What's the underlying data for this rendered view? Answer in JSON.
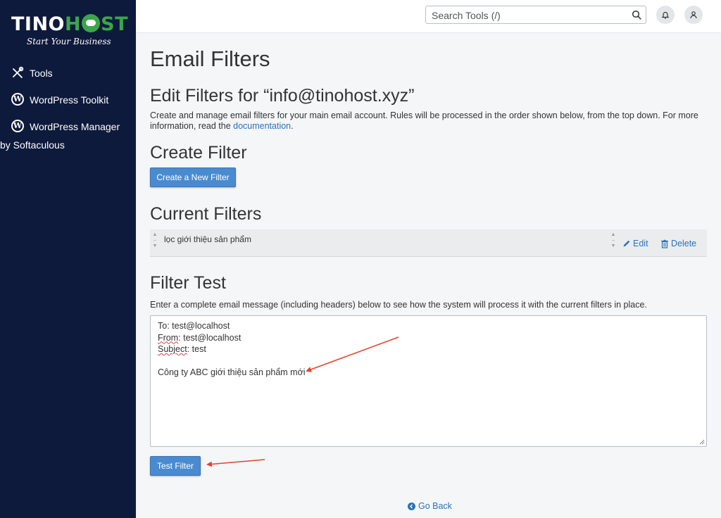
{
  "brand": {
    "part1": "TINO",
    "part2": "HOST",
    "tagline": "Start Your Business",
    "accent": "#3aa64a"
  },
  "sidebar": {
    "items": [
      {
        "label": "Tools",
        "icon": "tools-icon"
      },
      {
        "label": "WordPress Toolkit",
        "icon": "wordpress-icon"
      },
      {
        "label": "WordPress Manager",
        "label2": "by Softaculous",
        "icon": "wordpress-icon"
      }
    ]
  },
  "topbar": {
    "search_placeholder": "Search Tools (/)",
    "notifications_icon": "bell-icon",
    "user_icon": "user-icon"
  },
  "page": {
    "title": "Email Filters",
    "edit_title": "Edit Filters for “info@tinohost.xyz”",
    "description": "Create and manage email filters for your main email account. Rules will be processed in the order shown below, from the top down. For more information, read the ",
    "description_link": "documentation",
    "description_end": ".",
    "create_heading": "Create Filter",
    "create_button": "Create a New Filter",
    "current_heading": "Current Filters",
    "filters": [
      {
        "name": "lọc giới thiệu sản phẩm",
        "edit_label": "Edit",
        "delete_label": "Delete"
      }
    ],
    "test_heading": "Filter Test",
    "test_description": "Enter a complete email message (including headers) below to see how the system will process it with the current filters in place.",
    "test_message": {
      "to_label": "To",
      "to_value": ": test@localhost",
      "from_label": "From",
      "from_value": ": test@localhost",
      "subject_label": "Subject",
      "subject_value": ": test",
      "body": "Công ty ABC giới thiệu sản phẩm mới"
    },
    "test_button": "Test Filter",
    "go_back": "Go Back"
  },
  "colors": {
    "sidebar_bg": "#0e1a3c",
    "primary_button": "#4a8bd0",
    "link": "#2a73b8",
    "annotation_arrow": "#e0452b"
  }
}
